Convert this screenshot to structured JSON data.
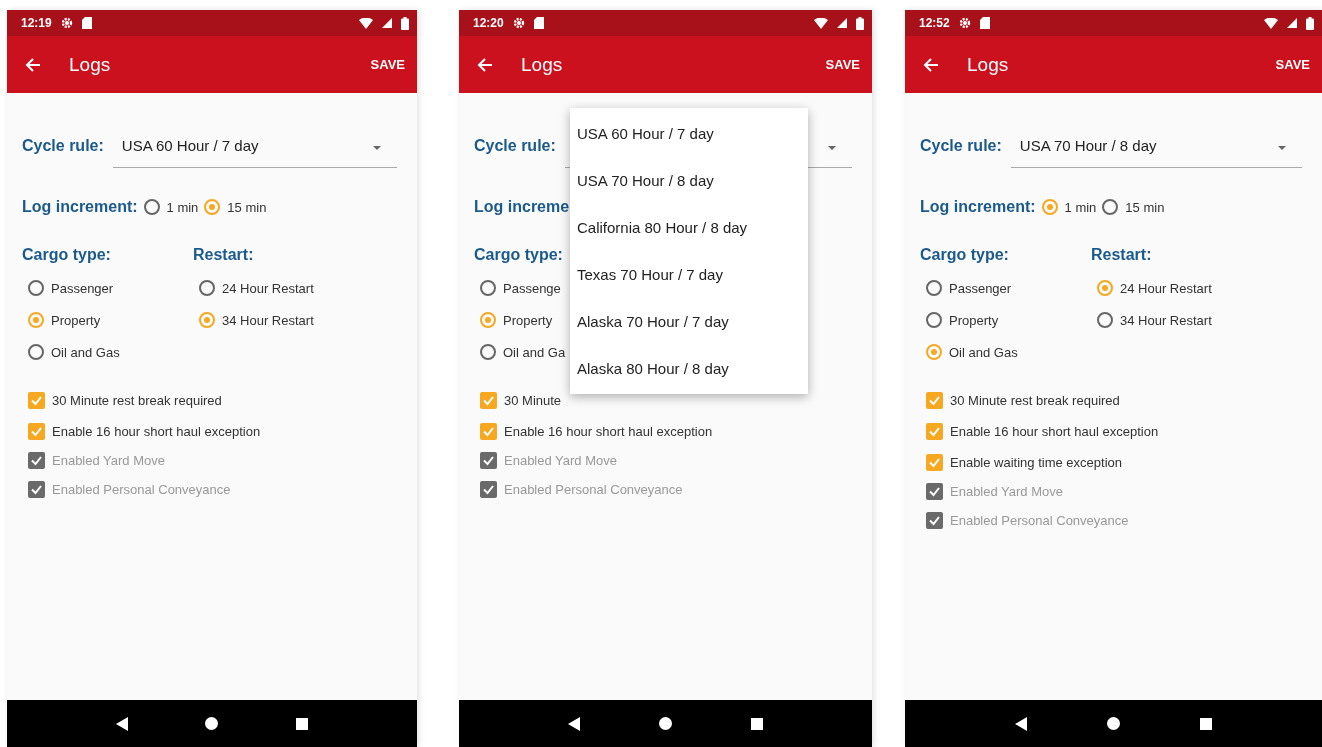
{
  "screens": [
    {
      "status_time": "12:19",
      "title": "Logs",
      "action": "SAVE",
      "cycle_label": "Cycle rule:",
      "cycle_value": "USA 60 Hour / 7 day",
      "increment": {
        "label": "Log increment:",
        "options": [
          {
            "label": "1 min",
            "selected": false
          },
          {
            "label": "15 min",
            "selected": true
          }
        ]
      },
      "cargo": {
        "label": "Cargo type:",
        "options": [
          {
            "label": "Passenger",
            "selected": false
          },
          {
            "label": "Property",
            "selected": true
          },
          {
            "label": "Oil and Gas",
            "selected": false
          }
        ]
      },
      "restart": {
        "label": "Restart:",
        "options": [
          {
            "label": "24 Hour Restart",
            "selected": false
          },
          {
            "label": "34 Hour Restart",
            "selected": true
          }
        ]
      },
      "checks": [
        {
          "label": "30 Minute rest break required",
          "checked": true,
          "disabled": false
        },
        {
          "label": "Enable 16 hour short haul exception",
          "checked": true,
          "disabled": false
        },
        {
          "label": "Enabled Yard Move",
          "checked": true,
          "disabled": true
        },
        {
          "label": "Enabled Personal Conveyance",
          "checked": true,
          "disabled": true
        }
      ]
    },
    {
      "status_time": "12:20",
      "title": "Logs",
      "action": "SAVE",
      "cycle_label": "Cycle rule:",
      "increment": {
        "label": "Log increme"
      },
      "cargo": {
        "label": "Cargo type:",
        "options": [
          {
            "label": "Passenge",
            "selected": false
          },
          {
            "label": "Property",
            "selected": true
          },
          {
            "label": "Oil and Ga",
            "selected": false
          }
        ]
      },
      "checks": [
        {
          "label": "30 Minute",
          "checked": true,
          "disabled": false
        },
        {
          "label": "Enable 16 hour short haul exception",
          "checked": true,
          "disabled": false
        },
        {
          "label": "Enabled Yard Move",
          "checked": true,
          "disabled": true
        },
        {
          "label": "Enabled Personal Conveyance",
          "checked": true,
          "disabled": true
        }
      ],
      "menu": {
        "items": [
          "USA 60 Hour / 7 day",
          "USA 70 Hour / 8 day",
          "California 80 Hour / 8 day",
          "Texas 70 Hour / 7 day",
          "Alaska 70 Hour / 7 day",
          "Alaska 80 Hour / 8 day"
        ]
      }
    },
    {
      "status_time": "12:52",
      "title": "Logs",
      "action": "SAVE",
      "cycle_label": "Cycle rule:",
      "cycle_value": "USA 70 Hour / 8 day",
      "increment": {
        "label": "Log increment:",
        "options": [
          {
            "label": "1 min",
            "selected": true
          },
          {
            "label": "15 min",
            "selected": false
          }
        ]
      },
      "cargo": {
        "label": "Cargo type:",
        "options": [
          {
            "label": "Passenger",
            "selected": false
          },
          {
            "label": "Property",
            "selected": false
          },
          {
            "label": "Oil and Gas",
            "selected": true
          }
        ]
      },
      "restart": {
        "label": "Restart:",
        "options": [
          {
            "label": "24 Hour Restart",
            "selected": true
          },
          {
            "label": "34 Hour Restart",
            "selected": false
          }
        ]
      },
      "checks": [
        {
          "label": "30 Minute rest break required",
          "checked": true,
          "disabled": false
        },
        {
          "label": "Enable 16 hour short haul exception",
          "checked": true,
          "disabled": false
        },
        {
          "label": "Enable waiting time exception",
          "checked": true,
          "disabled": false
        },
        {
          "label": "Enabled Yard Move",
          "checked": true,
          "disabled": true
        },
        {
          "label": "Enabled Personal Conveyance",
          "checked": true,
          "disabled": true
        }
      ]
    }
  ]
}
